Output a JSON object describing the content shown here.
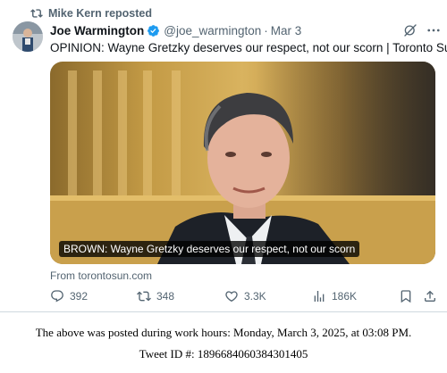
{
  "repost_bar": {
    "icon": "retweet-icon",
    "text": "Mike Kern reposted"
  },
  "author": {
    "name": "Joe Warmington",
    "handle": "@joe_warmington",
    "separator": "·",
    "date": "Mar 3",
    "verified_icon": "verified-badge-icon",
    "avatar_icon": "avatar"
  },
  "tweet": {
    "text": "OPINION: Wayne Gretzky deserves our respect, not our scorn | Toronto Sun"
  },
  "card": {
    "caption": "BROWN: Wayne Gretzky deserves our respect, not our scorn",
    "source": "From torontosun.com"
  },
  "actions": {
    "replies": "392",
    "reposts": "348",
    "likes": "3.3K",
    "views": "186K"
  },
  "footer": {
    "line1": "The above was posted during work hours: Monday, March 3, 2025, at 03:08 PM.",
    "line2": "Tweet ID #: 1896684060384301405"
  },
  "colors": {
    "text": "#0f1419",
    "muted": "#536471",
    "verified": "#1d9bf0",
    "border": "#cfd9de"
  }
}
